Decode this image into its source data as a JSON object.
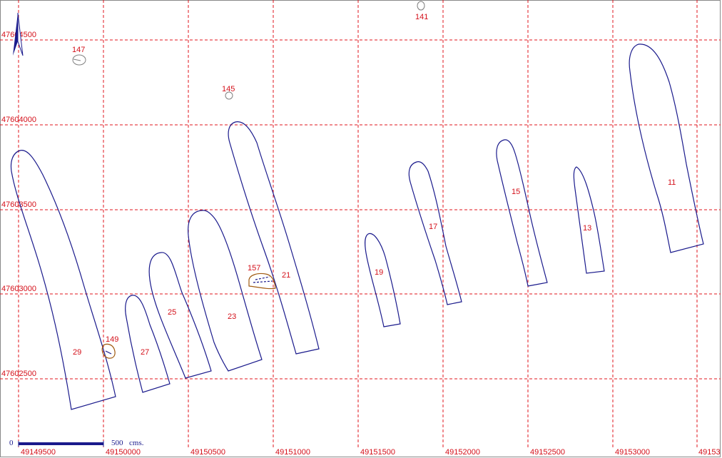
{
  "map": {
    "northing_labels": [
      "47604500",
      "47604000",
      "47603500",
      "47603000",
      "47602500"
    ],
    "easting_labels": [
      "49149500",
      "49150000",
      "49150500",
      "49151000",
      "49151500",
      "49152000",
      "49152500",
      "49153000",
      "49153"
    ],
    "scale_bar": {
      "start_label": "0",
      "end_label": "500",
      "unit_label": "cms."
    },
    "north_arrow": "north-arrow-icon",
    "features": [
      {
        "id": "11",
        "label": "11"
      },
      {
        "id": "13",
        "label": "13"
      },
      {
        "id": "15",
        "label": "15"
      },
      {
        "id": "17",
        "label": "17"
      },
      {
        "id": "19",
        "label": "19"
      },
      {
        "id": "21",
        "label": "21"
      },
      {
        "id": "23",
        "label": "23"
      },
      {
        "id": "25",
        "label": "25"
      },
      {
        "id": "27",
        "label": "27"
      },
      {
        "id": "29",
        "label": "29"
      },
      {
        "id": "141",
        "label": "141"
      },
      {
        "id": "145",
        "label": "145"
      },
      {
        "id": "147",
        "label": "147"
      },
      {
        "id": "149",
        "label": "149"
      },
      {
        "id": "157",
        "label": "157"
      }
    ],
    "colors": {
      "grid": "#e0141c",
      "outline": "#1a1a8c",
      "labels": "#d4101a"
    }
  }
}
